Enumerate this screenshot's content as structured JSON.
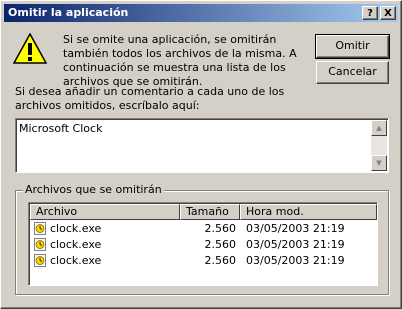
{
  "window": {
    "title": "Omitir la aplicación",
    "help_glyph": "?",
    "close_glyph": "X"
  },
  "message": "Si se omite una aplicación, se omitirán también todos los archivos de la misma. A continuación se muestra una lista de los archivos que se omitirán.",
  "buttons": {
    "omit": "Omitir",
    "cancel": "Cancelar"
  },
  "comment": {
    "prompt": "Si desea añadir un comentario a cada uno de los archivos omitidos, escríbalo aquí:",
    "value": "Microsoft Clock"
  },
  "files_group": {
    "label": "Archivos que se omitirán",
    "columns": [
      "Archivo",
      "Tamaño",
      "Hora mod."
    ],
    "rows": [
      {
        "name": "clock.exe",
        "size": "2.560",
        "modified": "03/05/2003 21:19"
      },
      {
        "name": "clock.exe",
        "size": "2.560",
        "modified": "03/05/2003 21:19"
      },
      {
        "name": "clock.exe",
        "size": "2.560",
        "modified": "03/05/2003 21:19"
      }
    ]
  },
  "icons": {
    "warning": "warning-icon",
    "file": "exe-file-icon"
  },
  "colors": {
    "title_start": "#0a246a",
    "title_end": "#a6caf0",
    "dialog_bg": "#d4d0c8",
    "warning_yellow": "#ffff00"
  }
}
